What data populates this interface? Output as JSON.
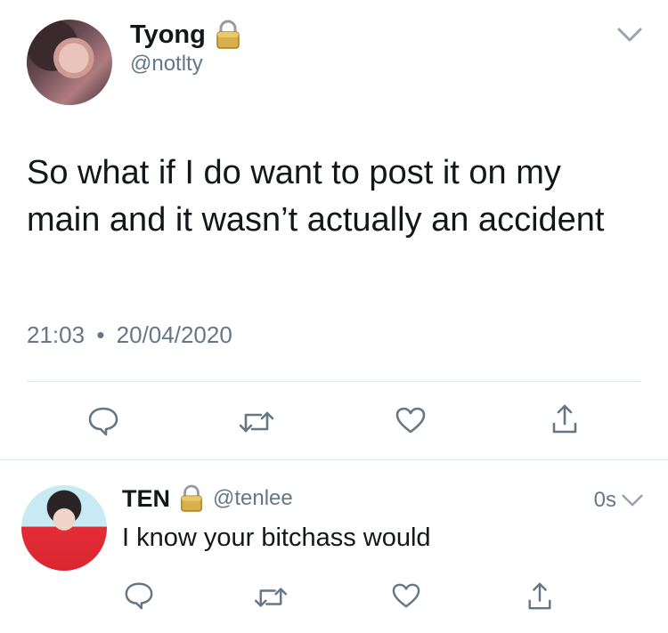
{
  "tweet": {
    "author_name": "Tyong",
    "author_handle": "@notlty",
    "text": "So what if I do want to post it on my main and it wasn’t actually an accident",
    "time": "21:03",
    "separator": "•",
    "date": "20/04/2020"
  },
  "reply": {
    "author_name": "TEN",
    "author_handle": "@tenlee",
    "age": "0s",
    "text": "I know your bitchass would"
  },
  "icons": {
    "lock": "padlock-icon",
    "menu": "chevron-down-icon",
    "reply": "reply-bubble-icon",
    "retweet": "retweet-icon",
    "like": "heart-icon",
    "share": "share-upload-icon"
  },
  "colors": {
    "text": "#14171a",
    "secondary": "#657786",
    "divider": "#e1e8ed",
    "lock_gold": "#c9a23b"
  }
}
